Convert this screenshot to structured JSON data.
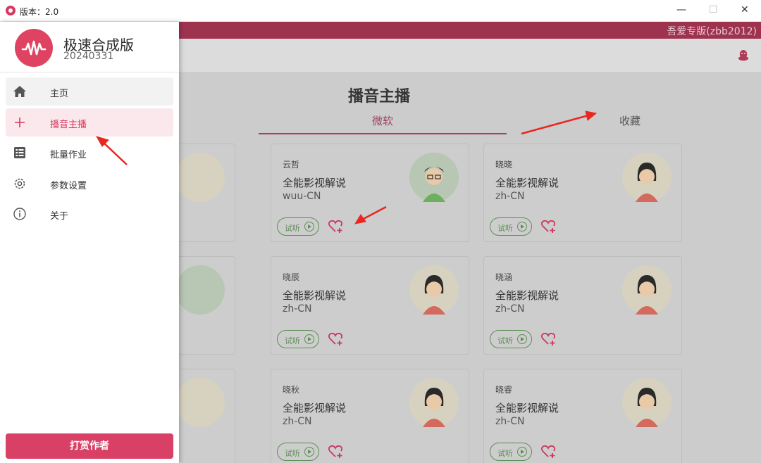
{
  "window": {
    "title": "版本：2.0",
    "controls": {
      "minimize": "—",
      "maximize": "☐",
      "close": "✕"
    }
  },
  "header": {
    "user_text": "吾爱专版(zbb2012)"
  },
  "drawer": {
    "app_name": "极速合成版",
    "app_version": "20240331",
    "nav": [
      {
        "label": "主页",
        "icon": "home-icon"
      },
      {
        "label": "播音主播",
        "icon": "plus-icon",
        "active": true
      },
      {
        "label": "批量作业",
        "icon": "list-icon"
      },
      {
        "label": "参数设置",
        "icon": "gear-icon"
      },
      {
        "label": "关于",
        "icon": "info-icon"
      }
    ],
    "reward_button": "打赏作者"
  },
  "main": {
    "title": "播音主播",
    "tabs": [
      {
        "label": "微软",
        "active": true
      },
      {
        "label": "收藏",
        "active": false
      }
    ],
    "cards": [
      {
        "name": "云哲",
        "style": "全能影视解说",
        "lang": "wuu-CN",
        "avatar": "male",
        "listen": "试听"
      },
      {
        "name": "晓晓",
        "style": "全能影视解说",
        "lang": "zh-CN",
        "avatar": "female",
        "listen": "试听"
      },
      {
        "name": "晓辰",
        "style": "全能影视解说",
        "lang": "zh-CN",
        "avatar": "female",
        "listen": "试听"
      },
      {
        "name": "晓涵",
        "style": "全能影视解说",
        "lang": "zh-CN",
        "avatar": "female",
        "listen": "试听"
      },
      {
        "name": "晓秋",
        "style": "全能影视解说",
        "lang": "zh-CN",
        "avatar": "female",
        "listen": "试听"
      },
      {
        "name": "晓睿",
        "style": "全能影视解说",
        "lang": "zh-CN",
        "avatar": "female",
        "listen": "试听"
      }
    ]
  },
  "colors": {
    "accent": "#d6385e",
    "listen_green": "#5c8f55",
    "overlay_header": "#9e3350"
  }
}
